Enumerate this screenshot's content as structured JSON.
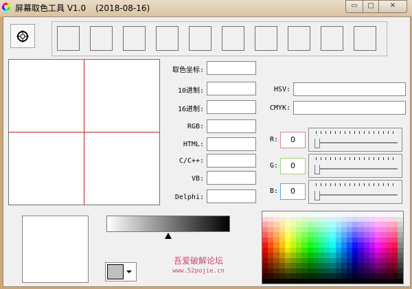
{
  "window": {
    "title": "屏幕取色工具 V1.0",
    "date": "(2018-08-16)",
    "minimize": "▭",
    "maximize": "□",
    "close": "✕"
  },
  "fields": {
    "coord": {
      "label": "取色坐标:",
      "value": ""
    },
    "dec": {
      "label": "10进制:",
      "value": ""
    },
    "hex": {
      "label": "16进制:",
      "value": ""
    },
    "rgb": {
      "label": "RGB:",
      "value": ""
    },
    "html": {
      "label": "HTML:",
      "value": ""
    },
    "cpp": {
      "label": "C/C++:",
      "value": ""
    },
    "vb": {
      "label": "VB:",
      "value": ""
    },
    "delphi": {
      "label": "Delphi:",
      "value": ""
    },
    "hsv": {
      "label": "HSV:",
      "value": ""
    },
    "cmyk": {
      "label": "CMYK:",
      "value": ""
    }
  },
  "channels": {
    "r": {
      "label": "R:",
      "value": "0",
      "color": "#e080a0"
    },
    "g": {
      "label": "G:",
      "value": "0",
      "color": "#a0d070"
    },
    "b": {
      "label": "B:",
      "value": "0",
      "color": "#60a8d8"
    }
  },
  "gradient": {
    "marker_fraction": 0.5
  },
  "selected_color": "#c0c0c0",
  "watermark": {
    "name": "吾爱破解论坛",
    "url": "www.52pojie.cn"
  }
}
